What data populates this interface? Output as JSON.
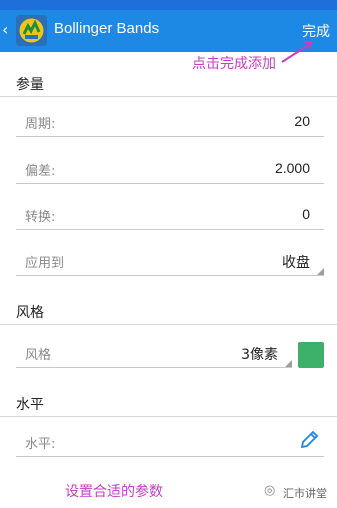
{
  "header": {
    "back_symbol": "‹",
    "title": "Bollinger Bands",
    "done_label": "完成",
    "accent_color": "#1e88e5",
    "icon": "metatrader-app-icon"
  },
  "annotations": {
    "top": "点击完成添加",
    "bottom": "设置合适的参数",
    "color": "#c43fc4"
  },
  "sections": {
    "params": {
      "title": "参量",
      "period": {
        "label": "周期:",
        "value": "20"
      },
      "deviation": {
        "label": "偏差:",
        "value": "2.000"
      },
      "shift": {
        "label": "转换:",
        "value": "0"
      },
      "apply_to": {
        "label": "应用到",
        "value": "收盘"
      }
    },
    "style": {
      "title": "风格",
      "style": {
        "label": "风格",
        "value": "3像素"
      },
      "color_swatch": "#3db06a"
    },
    "level": {
      "title": "水平",
      "level": {
        "label": "水平:",
        "icon": "pencil-icon"
      }
    }
  },
  "watermark": {
    "text": "汇市讲堂",
    "icon": "wechat-icon"
  }
}
